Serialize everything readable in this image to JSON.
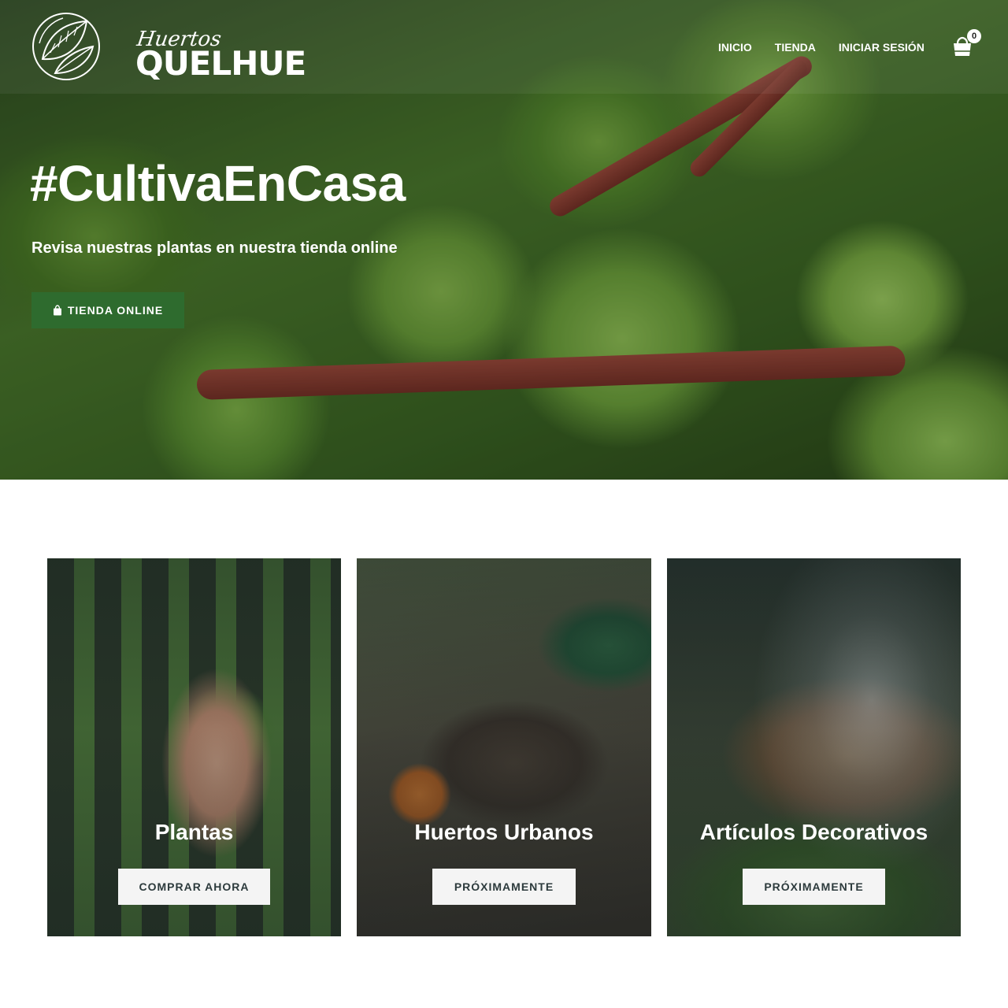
{
  "brand": {
    "script_text": "Huertos",
    "word_text": "QUELHUE"
  },
  "nav": {
    "items": [
      {
        "label": "INICIO"
      },
      {
        "label": "TIENDA"
      },
      {
        "label": "INICIAR SESIÓN"
      }
    ],
    "cart_count": "0",
    "cart_icon": "shopping-bag-icon"
  },
  "hero": {
    "title": "#CultivaEnCasa",
    "subtitle": "Revisa nuestras plantas en nuestra tienda online",
    "button_label": "TIENDA ONLINE",
    "button_icon": "shopping-bag-icon",
    "button_color": "#2e6b2e"
  },
  "cards": [
    {
      "title": "Plantas",
      "button_label": "COMPRAR AHORA"
    },
    {
      "title": "Huertos Urbanos",
      "button_label": "PRÓXIMAMENTE"
    },
    {
      "title": "Artículos Decorativos",
      "button_label": "PRÓXIMAMENTE"
    }
  ]
}
